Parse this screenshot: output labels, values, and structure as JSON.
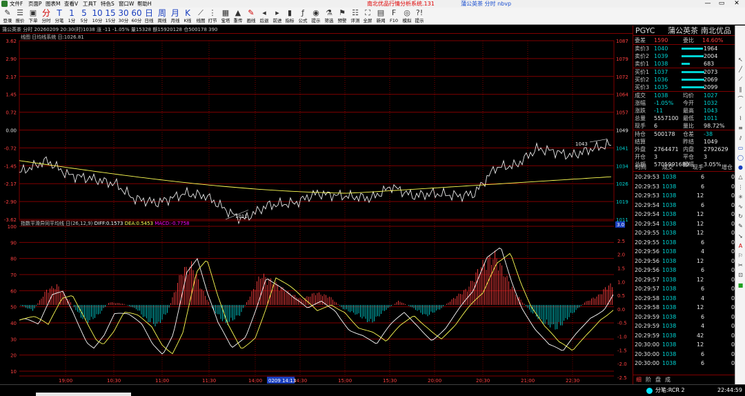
{
  "menubar": {
    "items": [
      "文件F",
      "页面P",
      "图表M",
      "查看V",
      "工具T",
      "特色S",
      "窗口W",
      "帮助H"
    ],
    "title": "南北优品行情分析系统.131",
    "title_b": "蒲公英茶  分时  nbvp",
    "win_min": "—",
    "win_restore": "▭",
    "win_close": "✕"
  },
  "toolbar": {
    "buttons_left": [
      {
        "icon": "login-icon",
        "glyph": "✎",
        "label": "登录"
      },
      {
        "icon": "report-icon",
        "glyph": "☰",
        "label": "报价"
      },
      {
        "icon": "order-icon",
        "glyph": "▣",
        "label": "下单"
      }
    ],
    "periods": [
      {
        "big": "分",
        "sub": "分时",
        "color": "#d00000"
      },
      {
        "big": "T",
        "sub": "分笔",
        "color": "#1a3fbf"
      },
      {
        "big": "1",
        "sub": "1分",
        "color": "#1a3fbf"
      },
      {
        "big": "5",
        "sub": "5分",
        "color": "#1a3fbf"
      },
      {
        "big": "10",
        "sub": "10分",
        "color": "#1a3fbf"
      },
      {
        "big": "15",
        "sub": "15分",
        "color": "#1a3fbf"
      },
      {
        "big": "30",
        "sub": "30分",
        "color": "#1a3fbf"
      },
      {
        "big": "60",
        "sub": "60分",
        "color": "#1a3fbf"
      },
      {
        "big": "日",
        "sub": "日线",
        "color": "#1a3fbf"
      },
      {
        "big": "周",
        "sub": "周线",
        "color": "#1a3fbf"
      },
      {
        "big": "月",
        "sub": "月线",
        "color": "#1a3fbf"
      },
      {
        "big": "K",
        "sub": "K线",
        "color": "#1a3fbf"
      }
    ],
    "tools": [
      {
        "icon": "line-chart-icon",
        "glyph": "⟋",
        "label": "线图"
      },
      {
        "icon": "tick-icon",
        "glyph": "⋮",
        "label": "打节"
      },
      {
        "icon": "grid-icon",
        "glyph": "▦",
        "label": "宝塔"
      },
      {
        "icon": "bookmark-icon",
        "glyph": "▲",
        "label": "重传"
      },
      {
        "icon": "pass-icon",
        "glyph": "传",
        "label": "重传"
      },
      {
        "icon": "pen-icon",
        "glyph": "✎",
        "label": "画线"
      },
      {
        "icon": "back-icon",
        "glyph": "◂",
        "label": "后退"
      },
      {
        "icon": "forward-icon",
        "glyph": "▸",
        "label": "前进"
      },
      {
        "icon": "indicator-icon",
        "glyph": "▮",
        "label": "指标"
      },
      {
        "icon": "formula-icon",
        "glyph": "ƒ",
        "label": "公式"
      },
      {
        "icon": "alert-icon",
        "glyph": "◉",
        "label": "提示"
      },
      {
        "icon": "filter-icon",
        "glyph": "⚗",
        "label": "筛选"
      },
      {
        "icon": "warning-icon",
        "glyph": "⚑",
        "label": "预警"
      },
      {
        "icon": "evaluate-icon",
        "glyph": "☷",
        "label": "评测"
      },
      {
        "icon": "fullscreen-icon",
        "glyph": "⛶",
        "label": "全屏"
      },
      {
        "icon": "news-icon",
        "glyph": "▤",
        "label": "新闻"
      },
      {
        "icon": "f10-icon",
        "glyph": "F",
        "label": "F10"
      },
      {
        "icon": "mode-icon",
        "glyph": "◎",
        "label": "模拟"
      },
      {
        "icon": "help-icon",
        "glyph": "?!",
        "label": "提示"
      }
    ]
  },
  "stockline": {
    "text": "蒲公英茶  分时  20260209 20:30(时)1038 涨 -11 -1.05% 量15328 额15920128 仓500178 390"
  },
  "price_chart": {
    "legend": "线图  日均线系统  日:1026.81",
    "left_axis": [
      "3.62",
      "2.90",
      "2.17",
      "1.45",
      "0.72",
      "0.00",
      "-0.72",
      "-1.45",
      "-2.17",
      "-2.90",
      "-3.62"
    ],
    "right_axis": [
      "1087",
      "1079",
      "1072",
      "1064",
      "1057",
      "1049",
      "1041",
      "1034",
      "1026",
      "1019",
      "1011"
    ],
    "low_label": "1011",
    "high_label": "1043"
  },
  "macd_chart": {
    "legend_name": "指数平滑异同平均线 日(26,12,9)",
    "diff_label": "DIFF:0.1573",
    "dea_label": "DEA:0.5453",
    "macd_label": "MACD:-0.7758",
    "left_axis": [
      "100",
      "90",
      "80",
      "70",
      "60",
      "50",
      "40",
      "30",
      "20",
      "10"
    ],
    "right_axis": [
      "3.0",
      "2.5",
      "2.0",
      "1.5",
      "1.0",
      "0.5",
      "0.0",
      "-0.5",
      "-1.0",
      "-1.5",
      "-2.0",
      "-2.5"
    ],
    "right_top_badge": "3.0",
    "time_axis": [
      "19:00",
      "10:30",
      "11:00",
      "11:30",
      "14:00",
      "14:30",
      "15:00",
      "15:30",
      "20:00",
      "20:30",
      "21:00",
      "22:30"
    ],
    "cursor_time": "0209 14:13"
  },
  "quote_panel": {
    "code": "PGYC",
    "name": "蒲公英茶",
    "brand": "南北优品",
    "weibi_label": "委差",
    "weibi_val": "1590",
    "ratio_label": "委比",
    "ratio_val": "14.60%",
    "asks": [
      {
        "label": "卖价3",
        "price": "1040",
        "vol": "1964",
        "frac": 0.78
      },
      {
        "label": "卖价2",
        "price": "1039",
        "vol": "2004",
        "frac": 0.8
      },
      {
        "label": "卖价1",
        "price": "1038",
        "vol": "683",
        "frac": 0.3
      }
    ],
    "bids": [
      {
        "label": "买价1",
        "price": "1037",
        "vol": "2073",
        "frac": 0.82
      },
      {
        "label": "买价2",
        "price": "1036",
        "vol": "2069",
        "frac": 0.82
      },
      {
        "label": "买价3",
        "price": "1035",
        "vol": "2099",
        "frac": 0.83
      }
    ],
    "stats": [
      {
        "l1": "成交",
        "v1": "1038",
        "l2": "均价",
        "v2": "1027",
        "c1": "c-down",
        "c2": "c-down"
      },
      {
        "l1": "涨幅",
        "v1": "-1.05%",
        "l2": "今开",
        "v2": "1032",
        "c1": "c-down",
        "c2": "c-down"
      },
      {
        "l1": "涨跌",
        "v1": "-11",
        "l2": "最高",
        "v2": "1043",
        "c1": "c-down",
        "c2": "c-down"
      },
      {
        "l1": "总量",
        "v1": "5557100",
        "l2": "最低",
        "v2": "1011",
        "c1": "c-white",
        "c2": "c-down"
      },
      {
        "l1": "现手",
        "v1": "6",
        "l2": "量比",
        "v2": "98.72%",
        "c1": "c-white",
        "c2": "c-white"
      }
    ],
    "stats2": [
      {
        "l1": "持仓",
        "v1": "500178",
        "l2": "仓差",
        "v2": "-38",
        "c1": "c-white",
        "c2": "c-down"
      },
      {
        "l1": "结算",
        "v1": "",
        "l2": "昨结",
        "v2": "1049",
        "c1": "c-white",
        "c2": "c-white"
      },
      {
        "l1": "外盘",
        "v1": "2764471",
        "l2": "内盘",
        "v2": "2792629",
        "c1": "c-white",
        "c2": "c-white"
      },
      {
        "l1": "开仓",
        "v1": "3",
        "l2": "平仓",
        "v2": "3",
        "c1": "c-white",
        "c2": "c-white"
      },
      {
        "l1": "总额",
        "v1": "5705991680",
        "l2": "振幅",
        "v2": "3.05%",
        "c1": "c-white",
        "c2": "c-white"
      }
    ],
    "ticks_header": {
      "time": "时间",
      "price": "成交",
      "vol": "现手",
      "oi": "增仓"
    },
    "ticks": [
      {
        "time": "20:29:53",
        "price": "1038",
        "vol": "6",
        "oi": "0"
      },
      {
        "time": "20:29:53",
        "price": "1038",
        "vol": "6",
        "oi": "0"
      },
      {
        "time": "20:29:53",
        "price": "1038",
        "vol": "12",
        "oi": "0"
      },
      {
        "time": "20:29:54",
        "price": "1038",
        "vol": "6",
        "oi": "0"
      },
      {
        "time": "20:29:54",
        "price": "1038",
        "vol": "12",
        "oi": "0"
      },
      {
        "time": "20:29:54",
        "price": "1038",
        "vol": "12",
        "oi": "0"
      },
      {
        "time": "20:29:55",
        "price": "1038",
        "vol": "12",
        "oi": "0"
      },
      {
        "time": "20:29:55",
        "price": "1038",
        "vol": "6",
        "oi": "0"
      },
      {
        "time": "20:29:56",
        "price": "1038",
        "vol": "4",
        "oi": "0"
      },
      {
        "time": "20:29:56",
        "price": "1038",
        "vol": "12",
        "oi": "0"
      },
      {
        "time": "20:29:56",
        "price": "1038",
        "vol": "6",
        "oi": "0"
      },
      {
        "time": "20:29:57",
        "price": "1038",
        "vol": "12",
        "oi": "0"
      },
      {
        "time": "20:29:57",
        "price": "1038",
        "vol": "6",
        "oi": "0"
      },
      {
        "time": "20:29:58",
        "price": "1038",
        "vol": "4",
        "oi": "0"
      },
      {
        "time": "20:29:58",
        "price": "1038",
        "vol": "12",
        "oi": "0"
      },
      {
        "time": "20:29:59",
        "price": "1038",
        "vol": "6",
        "oi": "0"
      },
      {
        "time": "20:29:59",
        "price": "1038",
        "vol": "4",
        "oi": "0"
      },
      {
        "time": "20:29:59",
        "price": "1038",
        "vol": "42",
        "oi": "0"
      },
      {
        "time": "20:30:00",
        "price": "1038",
        "vol": "12",
        "oi": "0"
      },
      {
        "time": "20:30:00",
        "price": "1038",
        "vol": "6",
        "oi": "0"
      },
      {
        "time": "20:30:00",
        "price": "1038",
        "vol": "6",
        "oi": "0"
      }
    ],
    "tabs": [
      "细",
      "阶",
      "盘",
      "成"
    ]
  },
  "statusbar": {
    "status": "分笔:RCR 2",
    "time": "22:44:59"
  },
  "colors": {
    "grid": "#800000",
    "price_line": "#e8e8e8",
    "avg_line": "#ffff54",
    "up": "#ff4040",
    "down": "#00d3d3",
    "diff": "#ffffff",
    "dea": "#ffff54",
    "macd_label": "#ff00ff"
  }
}
